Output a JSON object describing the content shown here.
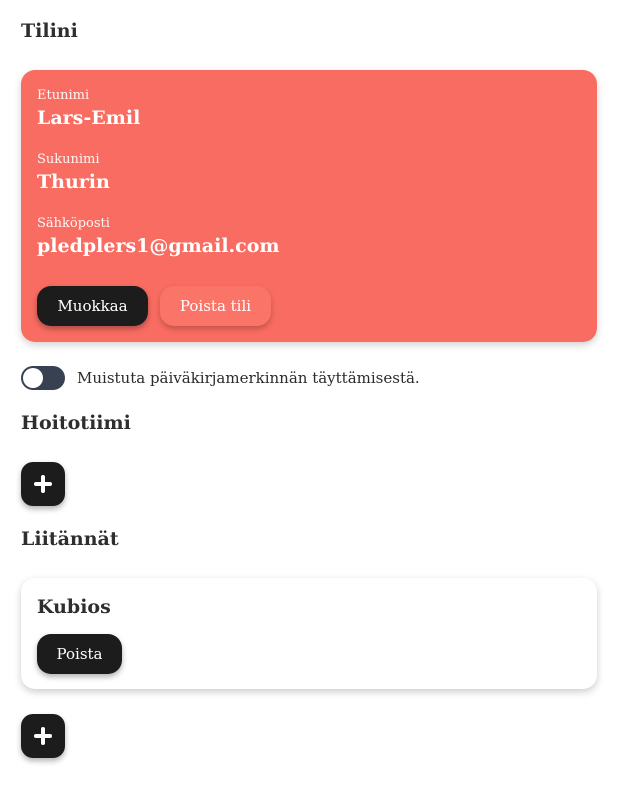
{
  "account": {
    "section_title": "Tilini",
    "first_name_label": "Etunimi",
    "first_name": "Lars-Emil",
    "last_name_label": "Sukunimi",
    "last_name": "Thurin",
    "email_label": "Sähköposti",
    "email": "pledplers1@gmail.com",
    "edit_button": "Muokkaa",
    "delete_button": "Poista tili",
    "card_color": "#f96c61"
  },
  "reminder": {
    "label": "Muistuta päiväkirjamerkinnän täyttämisestä.",
    "enabled": false
  },
  "care_team": {
    "section_title": "Hoitotiimi",
    "add_icon": "plus-icon"
  },
  "integrations": {
    "section_title": "Liitännät",
    "items": [
      {
        "name": "Kubios",
        "remove_button": "Poista"
      }
    ],
    "add_icon": "plus-icon"
  }
}
